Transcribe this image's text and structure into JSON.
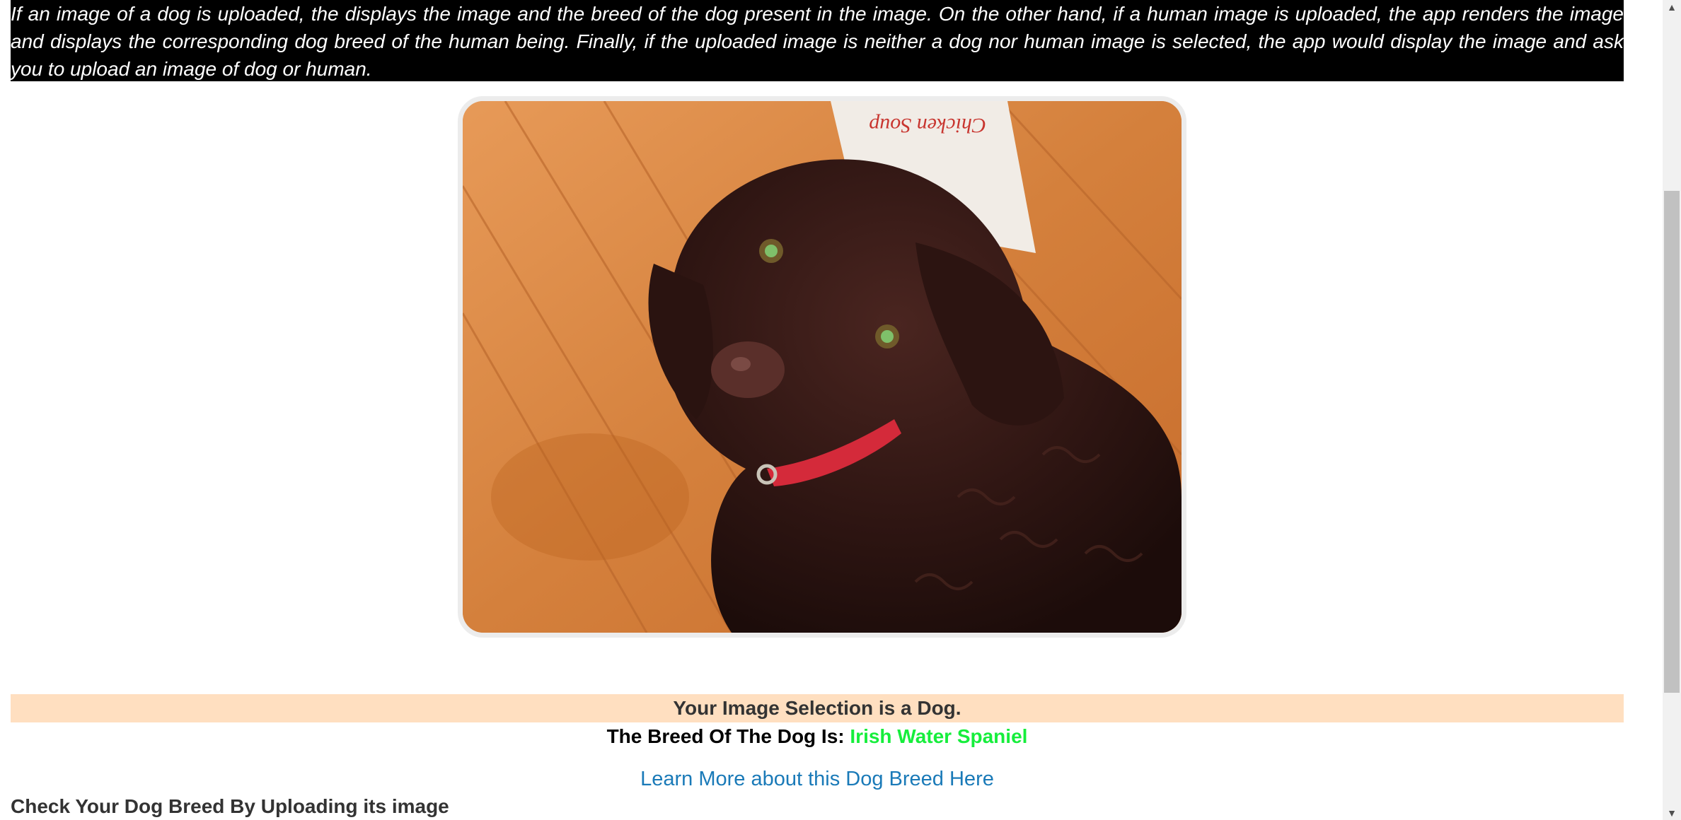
{
  "intro": {
    "text": "If an image of a dog is uploaded, the displays the image and the breed of the dog present in the image. On the other hand, if a human image is uploaded, the app renders the image and displays the corresponding dog breed of the human being. Finally, if the uploaded image is neither a dog nor human image is selected, the app would display the image and ask you to upload an image of dog or human."
  },
  "result": {
    "selection_text": "Your Image Selection is a Dog.",
    "breed_label": "The Breed Of The Dog Is: ",
    "breed_name": "Irish Water Spaniel"
  },
  "link": {
    "text": "Learn More about this Dog Breed Here"
  },
  "upload_section": {
    "heading": "Check Your Dog Breed By Uploading its image"
  },
  "scrollbar": {
    "up_icon": "arrow-up-icon",
    "down_icon": "arrow-down-icon"
  },
  "colors": {
    "intro_bg": "#000000",
    "banner_bg": "#ffdfc0",
    "breed_name": "#16ee3c",
    "link": "#1a7ab8"
  }
}
